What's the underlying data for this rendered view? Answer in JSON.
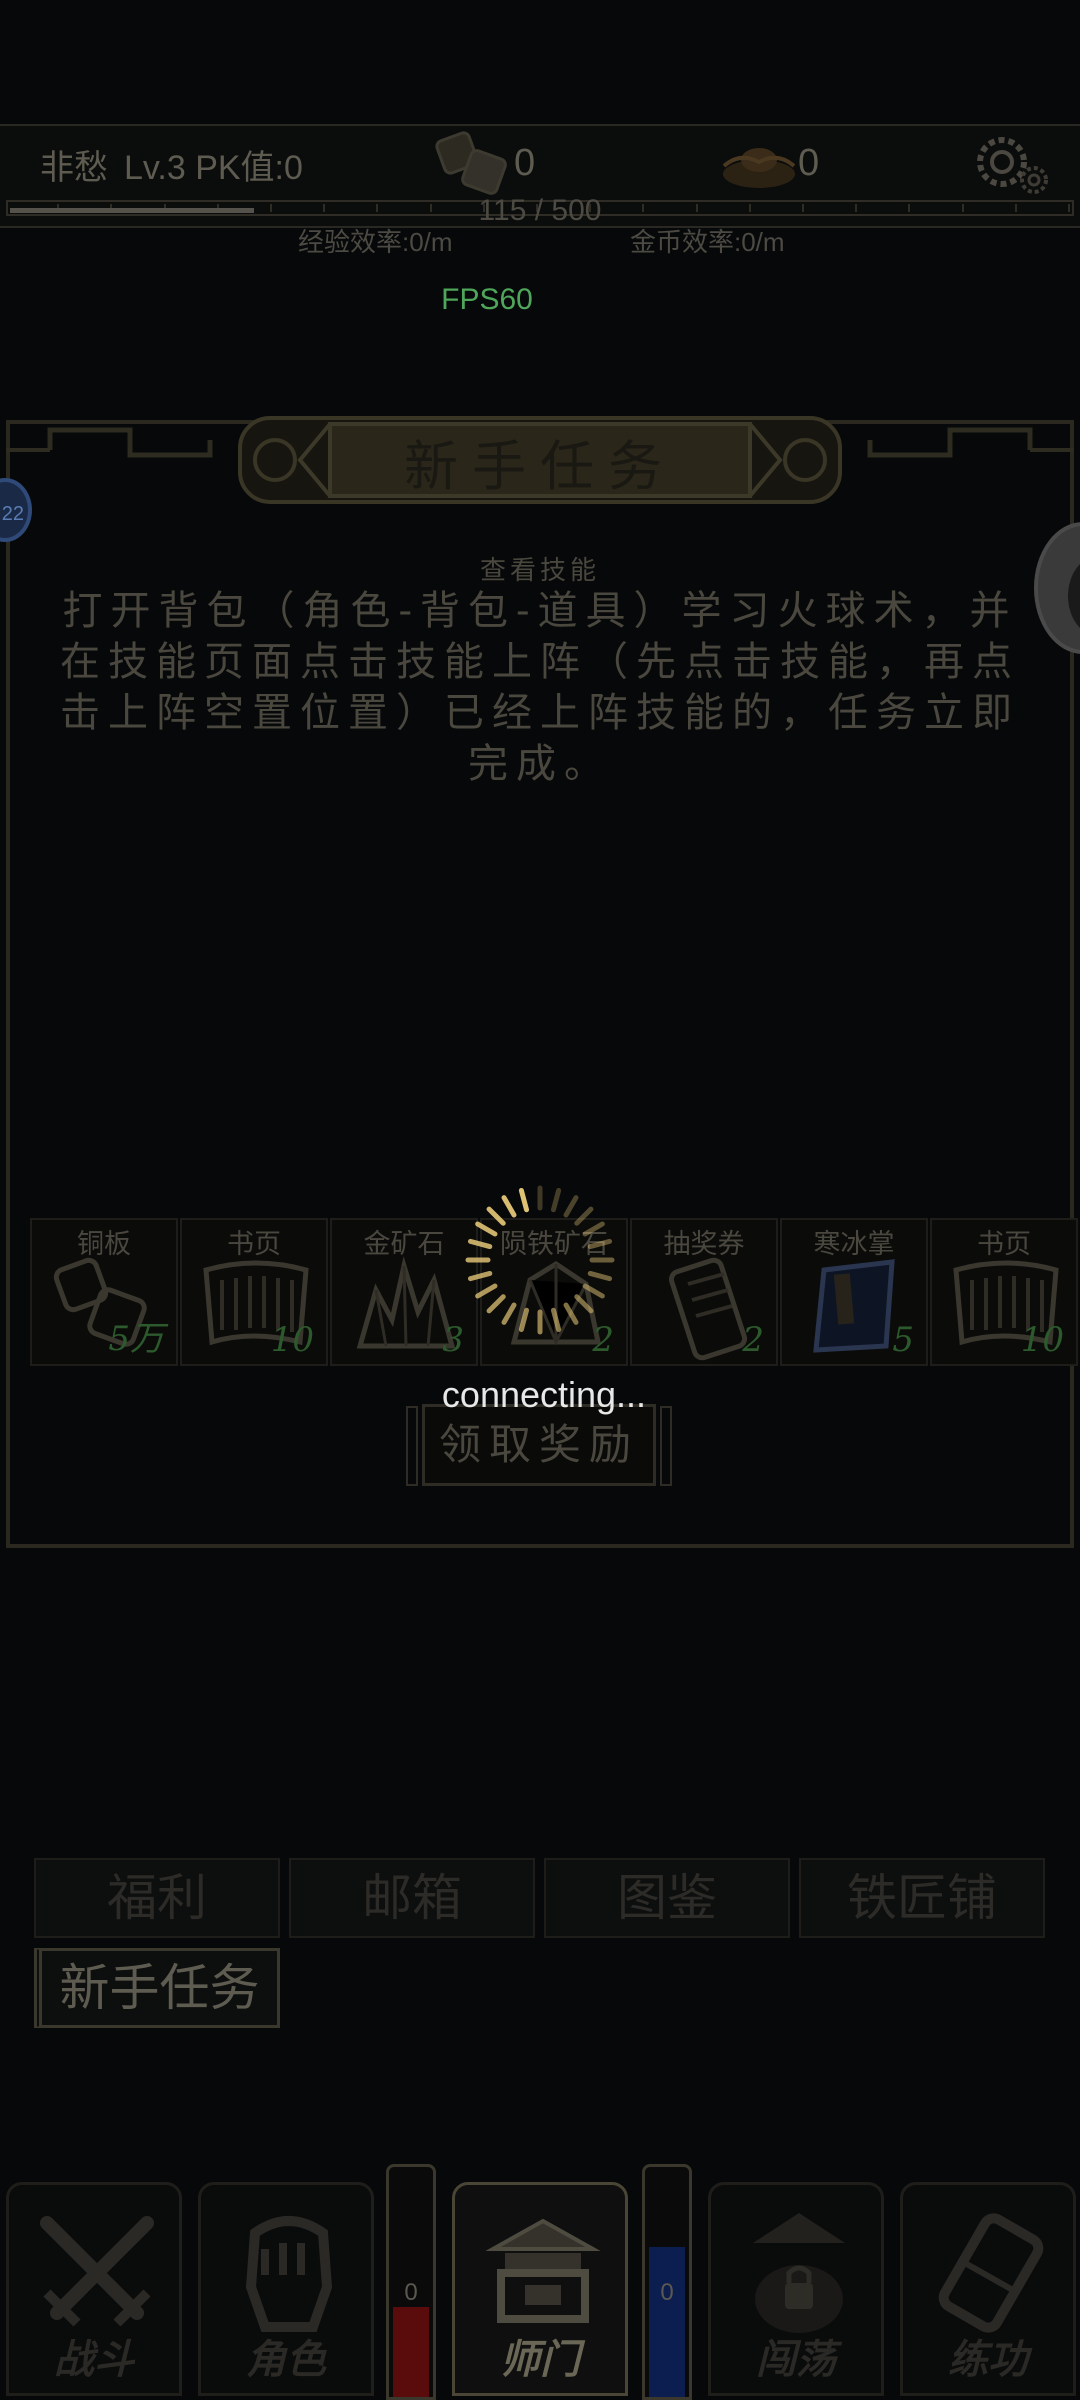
{
  "status_bar": {
    "player_name": "非愁",
    "level_pk": "Lv.3 PK值:0",
    "copper": "0",
    "gold": "0",
    "exp_value": "115 / 500",
    "exp_fraction": 0.23,
    "exp_rate": "经验效率:0/m",
    "gold_rate": "金币效率:0/m",
    "fps": "FPS60"
  },
  "quest": {
    "title": "新手任务",
    "subtitle": "查看技能",
    "description": "打开背包（角色-背包-道具）学习火球术，并在技能页面点击技能上阵（先点击技能，再点击上阵空置位置）已经上阵技能的，任务立即完成。",
    "avatar_left_label": "22",
    "claim_label": "领取奖励",
    "rewards": [
      {
        "name": "铜板",
        "count": "5万",
        "icon": "copper-coins-icon"
      },
      {
        "name": "书页",
        "count": "10",
        "icon": "book-pages-icon"
      },
      {
        "name": "金矿石",
        "count": "3",
        "icon": "gold-ore-icon"
      },
      {
        "name": "陨铁矿石",
        "count": "2",
        "icon": "meteor-iron-ore-icon"
      },
      {
        "name": "抽奖券",
        "count": "2",
        "icon": "lottery-ticket-icon"
      },
      {
        "name": "寒冰掌",
        "count": "5",
        "icon": "skill-book-icon"
      },
      {
        "name": "书页",
        "count": "10",
        "icon": "book-pages-icon"
      }
    ]
  },
  "loader": {
    "text": "connecting..."
  },
  "menu": {
    "welfare": "福利",
    "mail": "邮箱",
    "atlas": "图鉴",
    "smith": "铁匠铺",
    "newbie": "新手任务"
  },
  "nav": {
    "battle": "战斗",
    "role": "角色",
    "sect": "师门",
    "wander": "闯荡",
    "train": "练功",
    "hp_value": "0",
    "mp_value": "0"
  },
  "colors": {
    "background": "#06080a",
    "fps_green": "#4fa55a",
    "hp_red": "#5a0c0c",
    "mp_blue": "#0c1e50",
    "gold_frame": "#2a281f"
  }
}
